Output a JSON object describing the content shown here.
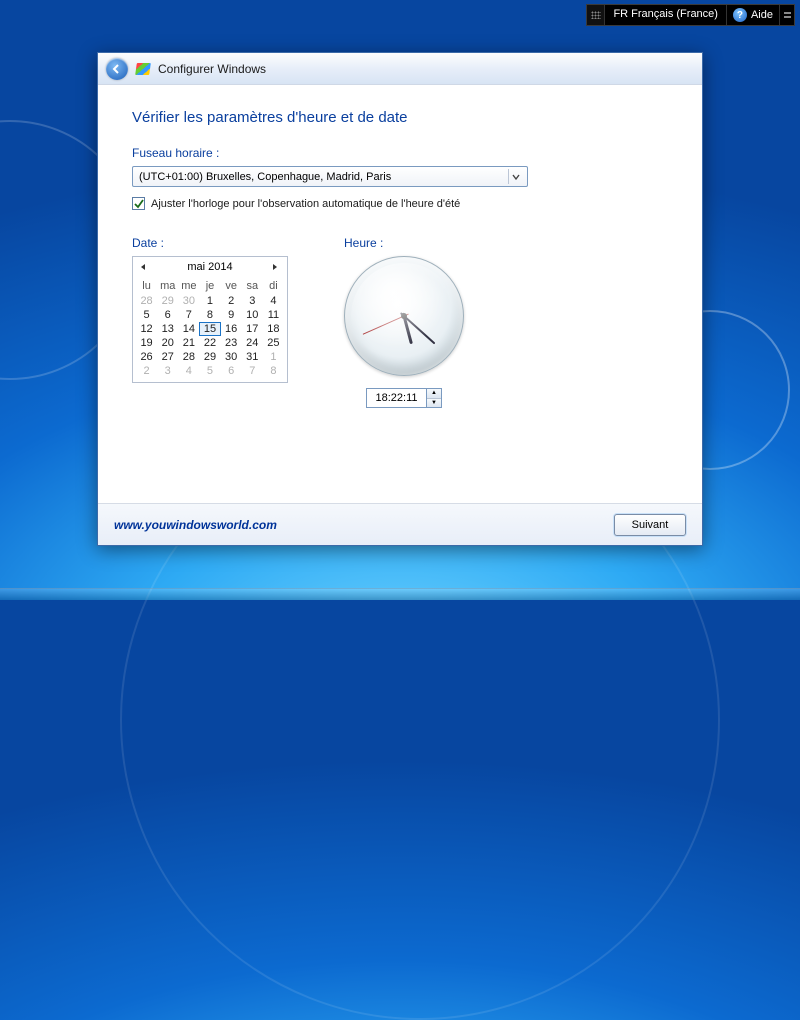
{
  "topbar": {
    "lang": "FR Français (France)",
    "help": "Aide"
  },
  "window": {
    "title": "Configurer Windows",
    "heading": "Vérifier les paramètres d'heure et de date",
    "tz_label": "Fuseau horaire :",
    "tz_value": "(UTC+01:00) Bruxelles, Copenhague, Madrid, Paris",
    "dst_label": "Ajuster l'horloge pour l'observation automatique de l'heure d'été",
    "dst_checked": true,
    "date_label": "Date :",
    "time_label": "Heure :",
    "time_value": "18:22:11",
    "next": "Suivant",
    "url": "www.youwindowsworld.com"
  },
  "calendar": {
    "month": "mai 2014",
    "day_headers": [
      "lu",
      "ma",
      "me",
      "je",
      "ve",
      "sa",
      "di"
    ],
    "weeks": [
      [
        {
          "n": 28,
          "other": true
        },
        {
          "n": 29,
          "other": true
        },
        {
          "n": 30,
          "other": true
        },
        {
          "n": 1
        },
        {
          "n": 2
        },
        {
          "n": 3
        },
        {
          "n": 4
        }
      ],
      [
        {
          "n": 5
        },
        {
          "n": 6
        },
        {
          "n": 7
        },
        {
          "n": 8
        },
        {
          "n": 9
        },
        {
          "n": 10
        },
        {
          "n": 11
        }
      ],
      [
        {
          "n": 12
        },
        {
          "n": 13
        },
        {
          "n": 14
        },
        {
          "n": 15,
          "sel": true
        },
        {
          "n": 16
        },
        {
          "n": 17
        },
        {
          "n": 18
        }
      ],
      [
        {
          "n": 19
        },
        {
          "n": 20
        },
        {
          "n": 21
        },
        {
          "n": 22
        },
        {
          "n": 23
        },
        {
          "n": 24
        },
        {
          "n": 25
        }
      ],
      [
        {
          "n": 26
        },
        {
          "n": 27
        },
        {
          "n": 28
        },
        {
          "n": 29
        },
        {
          "n": 30
        },
        {
          "n": 31
        },
        {
          "n": 1,
          "other": true
        }
      ],
      [
        {
          "n": 2,
          "other": true
        },
        {
          "n": 3,
          "other": true
        },
        {
          "n": 4,
          "other": true
        },
        {
          "n": 5,
          "other": true
        },
        {
          "n": 6,
          "other": true
        },
        {
          "n": 7,
          "other": true
        },
        {
          "n": 8,
          "other": true
        }
      ]
    ]
  }
}
